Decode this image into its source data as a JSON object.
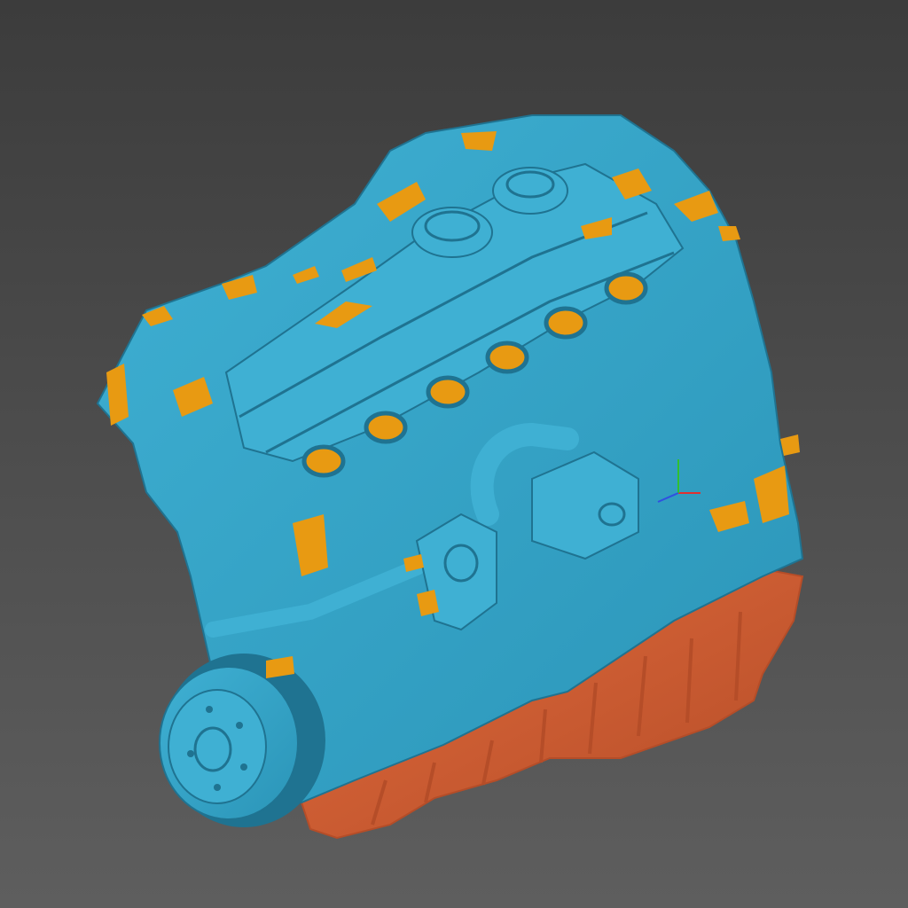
{
  "viewport": {
    "background_top": "#3c3c3c",
    "background_bottom": "#5e5e5e"
  },
  "model": {
    "primary_color": "#2b95b8",
    "primary_shade": "#1f7391",
    "primary_highlight": "#3fb0d3",
    "reference_color": "#e89a12",
    "oil_pan_color": "#e06a3c",
    "oil_pan_shade": "#b54d28"
  },
  "axis_gizmo": {
    "icon": "axis-triad-icon",
    "x_color": "#e03030",
    "y_color": "#30c030",
    "z_color": "#3050e0"
  }
}
